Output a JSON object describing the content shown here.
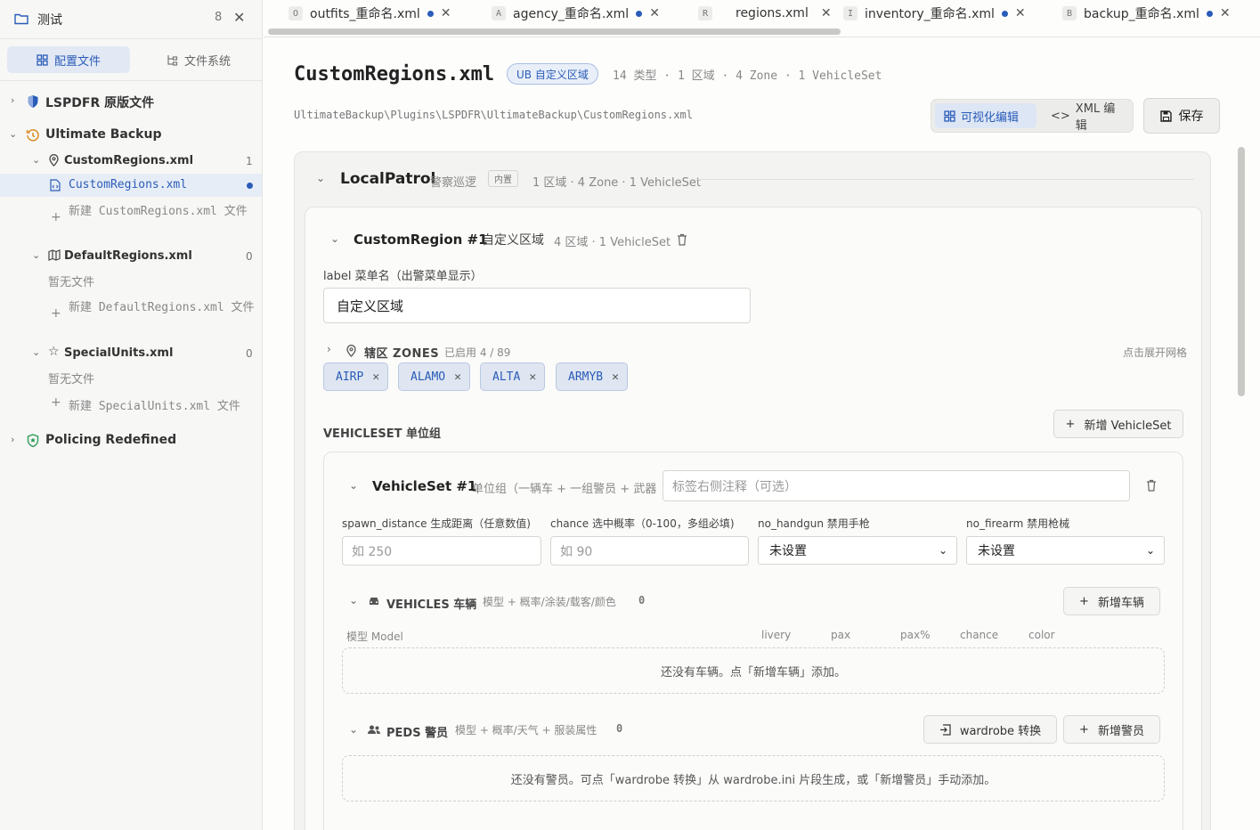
{
  "sidebar": {
    "workspace_title": "测试",
    "workspace_count": "8",
    "tabs": [
      {
        "label": "配置文件"
      },
      {
        "label": "文件系统"
      }
    ],
    "tree": {
      "lspdfr": {
        "label": "LSPDFR 原版文件"
      },
      "ultimate": {
        "label": "Ultimate Backup"
      },
      "custom_regions": {
        "label": "CustomRegions.xml",
        "count": "1"
      },
      "custom_regions_file": {
        "label": "CustomRegions.xml"
      },
      "new_custom": {
        "label": "新建 CustomRegions.xml 文件"
      },
      "default_regions": {
        "label": "DefaultRegions.xml",
        "count": "0"
      },
      "default_empty": "暂无文件",
      "new_default": {
        "label": "新建 DefaultRegions.xml 文件"
      },
      "special_units": {
        "label": "SpecialUnits.xml",
        "count": "0"
      },
      "special_empty": "暂无文件",
      "new_special": {
        "label": "新建 SpecialUnits.xml 文件"
      },
      "policing": {
        "label": "Policing Redefined"
      }
    }
  },
  "tabs": [
    {
      "badge": "O",
      "label": "outfits_重命名.xml",
      "modified": true
    },
    {
      "badge": "A",
      "label": "agency_重命名.xml",
      "modified": true
    },
    {
      "badge": "R",
      "label": "regions.xml",
      "modified": false
    },
    {
      "badge": "I",
      "label": "inventory_重命名.xml",
      "modified": true
    },
    {
      "badge": "B",
      "label": "backup_重命名.xml",
      "modified": true
    }
  ],
  "header": {
    "title": "CustomRegions.xml",
    "badge": "UB 自定义区域",
    "meta": "14 类型 · 1 区域 · 4 Zone · 1 VehicleSet",
    "path": "UltimateBackup\\Plugins\\LSPDFR\\UltimateBackup\\CustomRegions.xml",
    "mode_visual": "可视化编辑",
    "mode_xml": "XML 编辑",
    "save": "保存"
  },
  "local_patrol": {
    "title": "LocalPatrol",
    "subtitle": "警察巡逻",
    "tag": "内置",
    "meta": "1 区域 · 4 Zone · 1 VehicleSet"
  },
  "region": {
    "title": "CustomRegion #1",
    "subtitle": "自定义区域",
    "meta": "4 区域 · 1 VehicleSet",
    "label_field": "label 菜单名（出警菜单显示）",
    "label_value": "自定义区域",
    "zones_title": "辖区 ZONES",
    "zones_meta": "已启用 4 / 89",
    "zones_hint": "点击展开网格",
    "zones": [
      "AIRP",
      "ALAMO",
      "ALTA",
      "ARMYB"
    ],
    "vehicleset_title": "VEHICLESET 单位组",
    "add_vehicleset": "新增 VehicleSet"
  },
  "vehicleset": {
    "title": "VehicleSet #1",
    "subtitle": "单位组（一辆车 + 一组警员 + 武器",
    "note_placeholder": "标签右侧注释（可选）",
    "spawn_label": "spawn_distance 生成距离（任意数值)",
    "spawn_placeholder": "如 250",
    "chance_label": "chance 选中概率（0-100，多组必填)",
    "chance_placeholder": "如 90",
    "no_handgun_label": "no_handgun 禁用手枪",
    "no_handgun_value": "未设置",
    "no_firearm_label": "no_firearm 禁用枪械",
    "no_firearm_value": "未设置",
    "vehicles_title": "VEHICLES 车辆",
    "vehicles_meta": "模型 + 概率/涂装/载客/颜色",
    "vehicles_count": "0",
    "add_vehicle": "新增车辆",
    "vehicle_columns": [
      "模型 Model",
      "livery",
      "pax",
      "pax%",
      "chance",
      "color"
    ],
    "vehicles_empty": "还没有车辆。点「新增车辆」添加。",
    "peds_title": "PEDS 警员",
    "peds_meta": "模型 + 概率/天气 + 服装属性",
    "peds_count": "0",
    "wardrobe_btn": "wardrobe 转换",
    "add_ped": "新增警员",
    "peds_empty": "还没有警员。可点「wardrobe 转换」从 wardrobe.ini 片段生成，或「新增警员」手动添加。"
  },
  "colors": {
    "accent": "#2a5cb8",
    "accent_bg": "#e2e9f4",
    "badge_green": "#2e9b57",
    "clock_orange": "#d98a1e"
  }
}
